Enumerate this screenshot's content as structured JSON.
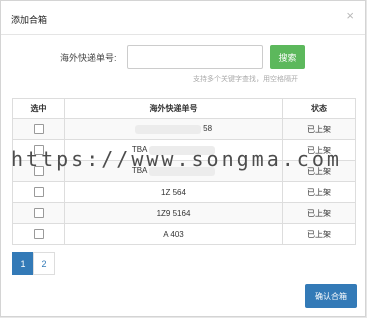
{
  "dialog": {
    "title": "添加合箱",
    "close_icon": "×"
  },
  "search": {
    "label": "海外快递单号:",
    "value": "",
    "placeholder": "",
    "button_label": "搜索",
    "hint": "支持多个关键字查找，用空格隔开"
  },
  "table": {
    "headers": [
      "选中",
      "海外快递单号",
      "状态"
    ],
    "rows": [
      {
        "tracking_no": "58",
        "status": "已上架"
      },
      {
        "tracking_no": "TBA",
        "status": "已上架"
      },
      {
        "tracking_no": "TBA",
        "status": "已上架"
      },
      {
        "tracking_no": "1Z 564",
        "status": "已上架"
      },
      {
        "tracking_no": "1Z9 5164",
        "status": "已上架"
      },
      {
        "tracking_no": "A 403",
        "status": "已上架"
      }
    ]
  },
  "watermark": "https://www.songma.com",
  "pagination": {
    "pages": [
      "1",
      "2"
    ],
    "current": "1"
  },
  "footer": {
    "confirm_label": "确认合箱"
  }
}
